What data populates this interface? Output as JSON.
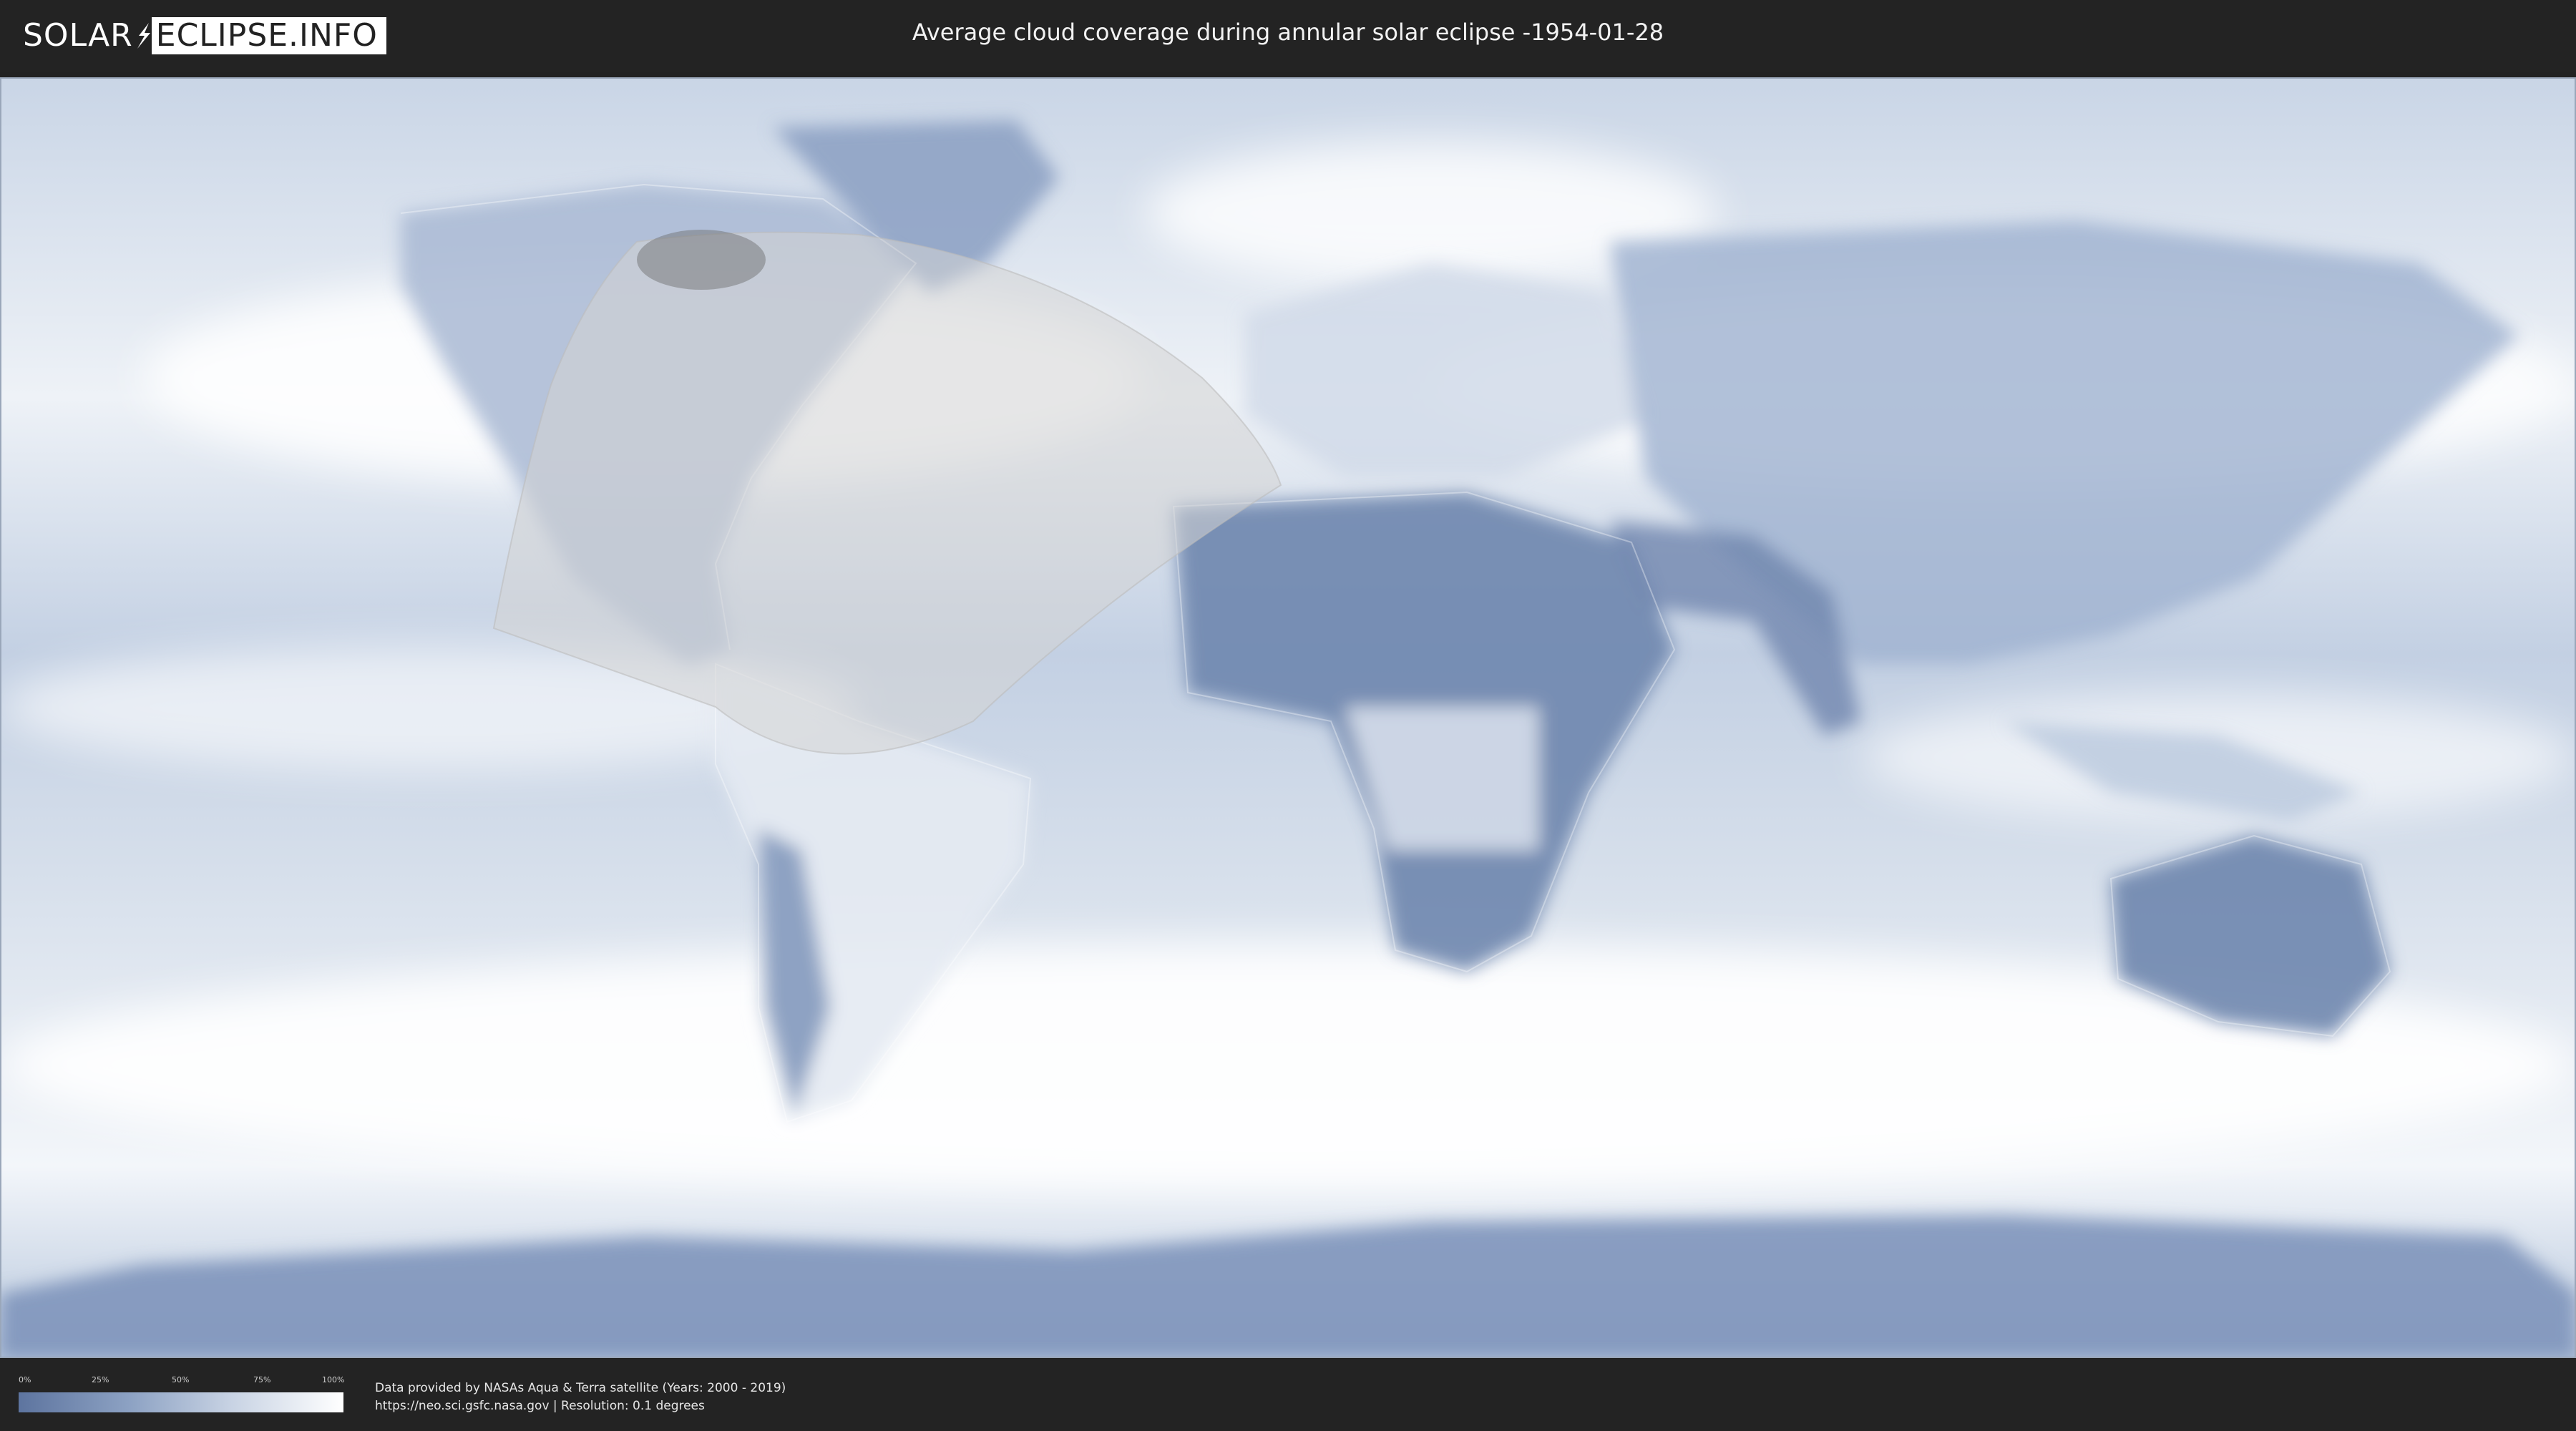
{
  "header": {
    "logo_left": "SOLAR",
    "logo_right": "ECLIPSE.INFO",
    "title": "Average cloud coverage during annular solar eclipse -1954-01-28"
  },
  "legend": {
    "ticks": [
      "0%",
      "25%",
      "50%",
      "75%",
      "100%"
    ],
    "gradient_colors": [
      "#5d749f",
      "#8ea3c4",
      "#c7d2e3",
      "#ffffff"
    ]
  },
  "credits": {
    "line1": "Data provided by NASAs Aqua & Terra satellite (Years: 2000 - 2019)",
    "line2": "https://neo.sci.gsfc.nasa.gov | Resolution: 0.1 degrees"
  },
  "map": {
    "colors": {
      "ocean_clear": "#dfe6ef",
      "land_clear": "#6f86ae",
      "cloud_white": "#ffffff",
      "eclipse_zone": "#cccccc"
    }
  }
}
